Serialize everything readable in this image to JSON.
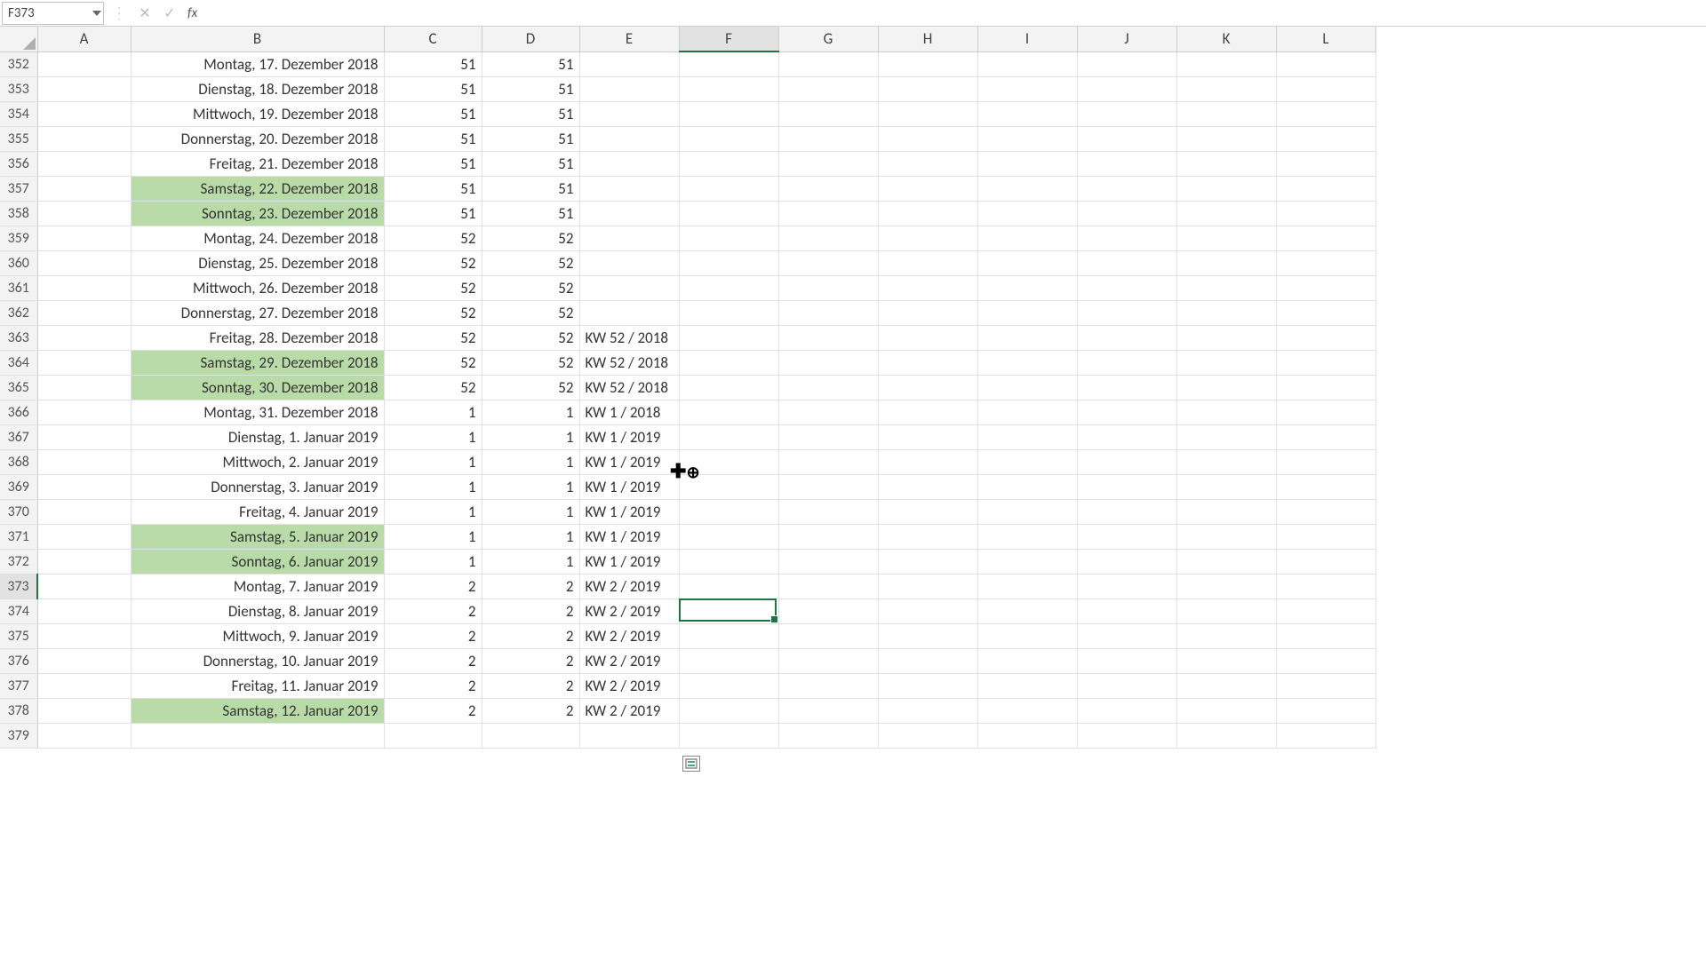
{
  "nameBox": "F373",
  "formulaInput": "",
  "columns": [
    "A",
    "B",
    "C",
    "D",
    "E",
    "F",
    "G",
    "H",
    "I",
    "J",
    "K",
    "L"
  ],
  "selectedCol": "F",
  "selectedRow": 373,
  "rows": [
    {
      "n": 352,
      "b": "Montag, 17. Dezember 2018",
      "c": "51",
      "d": "51",
      "e": "",
      "wk": false
    },
    {
      "n": 353,
      "b": "Dienstag, 18. Dezember 2018",
      "c": "51",
      "d": "51",
      "e": "",
      "wk": false
    },
    {
      "n": 354,
      "b": "Mittwoch, 19. Dezember 2018",
      "c": "51",
      "d": "51",
      "e": "",
      "wk": false
    },
    {
      "n": 355,
      "b": "Donnerstag, 20. Dezember 2018",
      "c": "51",
      "d": "51",
      "e": "",
      "wk": false
    },
    {
      "n": 356,
      "b": "Freitag, 21. Dezember 2018",
      "c": "51",
      "d": "51",
      "e": "",
      "wk": false
    },
    {
      "n": 357,
      "b": "Samstag, 22. Dezember 2018",
      "c": "51",
      "d": "51",
      "e": "",
      "wk": true
    },
    {
      "n": 358,
      "b": "Sonntag, 23. Dezember 2018",
      "c": "51",
      "d": "51",
      "e": "",
      "wk": true
    },
    {
      "n": 359,
      "b": "Montag, 24. Dezember 2018",
      "c": "52",
      "d": "52",
      "e": "",
      "wk": false
    },
    {
      "n": 360,
      "b": "Dienstag, 25. Dezember 2018",
      "c": "52",
      "d": "52",
      "e": "",
      "wk": false
    },
    {
      "n": 361,
      "b": "Mittwoch, 26. Dezember 2018",
      "c": "52",
      "d": "52",
      "e": "",
      "wk": false
    },
    {
      "n": 362,
      "b": "Donnerstag, 27. Dezember 2018",
      "c": "52",
      "d": "52",
      "e": "",
      "wk": false
    },
    {
      "n": 363,
      "b": "Freitag, 28. Dezember 2018",
      "c": "52",
      "d": "52",
      "e": "KW 52 / 2018",
      "wk": false
    },
    {
      "n": 364,
      "b": "Samstag, 29. Dezember 2018",
      "c": "52",
      "d": "52",
      "e": "KW 52 / 2018",
      "wk": true
    },
    {
      "n": 365,
      "b": "Sonntag, 30. Dezember 2018",
      "c": "52",
      "d": "52",
      "e": "KW 52 / 2018",
      "wk": true
    },
    {
      "n": 366,
      "b": "Montag, 31. Dezember 2018",
      "c": "1",
      "d": "1",
      "e": "KW 1 / 2018",
      "wk": false
    },
    {
      "n": 367,
      "b": "Dienstag, 1. Januar 2019",
      "c": "1",
      "d": "1",
      "e": "KW 1 / 2019",
      "wk": false
    },
    {
      "n": 368,
      "b": "Mittwoch, 2. Januar 2019",
      "c": "1",
      "d": "1",
      "e": "KW 1 / 2019",
      "wk": false
    },
    {
      "n": 369,
      "b": "Donnerstag, 3. Januar 2019",
      "c": "1",
      "d": "1",
      "e": "KW 1 / 2019",
      "wk": false
    },
    {
      "n": 370,
      "b": "Freitag, 4. Januar 2019",
      "c": "1",
      "d": "1",
      "e": "KW 1 / 2019",
      "wk": false
    },
    {
      "n": 371,
      "b": "Samstag, 5. Januar 2019",
      "c": "1",
      "d": "1",
      "e": "KW 1 / 2019",
      "wk": true
    },
    {
      "n": 372,
      "b": "Sonntag, 6. Januar 2019",
      "c": "1",
      "d": "1",
      "e": "KW 1 / 2019",
      "wk": true
    },
    {
      "n": 373,
      "b": "Montag, 7. Januar 2019",
      "c": "2",
      "d": "2",
      "e": "KW 2 / 2019",
      "wk": false
    },
    {
      "n": 374,
      "b": "Dienstag, 8. Januar 2019",
      "c": "2",
      "d": "2",
      "e": "KW 2 / 2019",
      "wk": false
    },
    {
      "n": 375,
      "b": "Mittwoch, 9. Januar 2019",
      "c": "2",
      "d": "2",
      "e": "KW 2 / 2019",
      "wk": false
    },
    {
      "n": 376,
      "b": "Donnerstag, 10. Januar 2019",
      "c": "2",
      "d": "2",
      "e": "KW 2 / 2019",
      "wk": false
    },
    {
      "n": 377,
      "b": "Freitag, 11. Januar 2019",
      "c": "2",
      "d": "2",
      "e": "KW 2 / 2019",
      "wk": false
    },
    {
      "n": 378,
      "b": "Samstag, 12. Januar 2019",
      "c": "2",
      "d": "2",
      "e": "KW 2 / 2019",
      "wk": true
    },
    {
      "n": 379,
      "b": "",
      "c": "",
      "d": "",
      "e": "",
      "wk": false
    }
  ]
}
